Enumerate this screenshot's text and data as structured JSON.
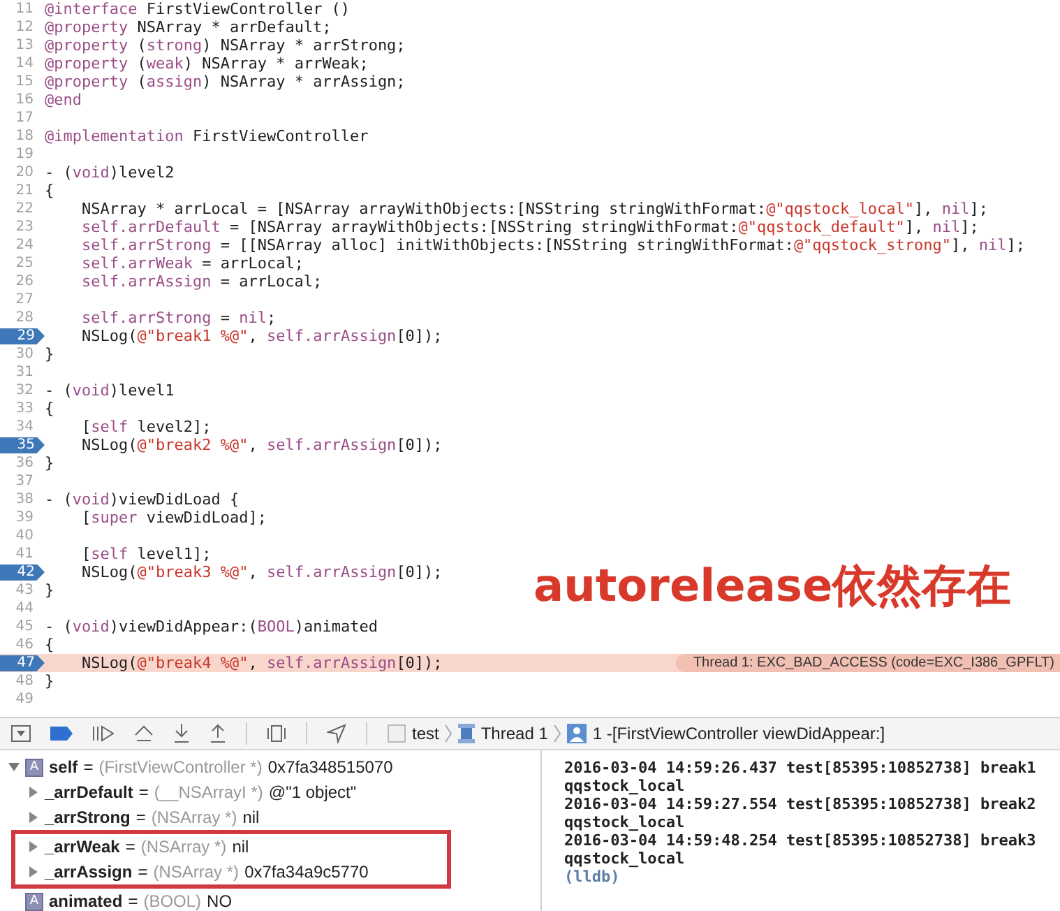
{
  "editor": {
    "lines": [
      {
        "number": "11",
        "tokens": [
          {
            "kind": "keyword",
            "text": "@interface"
          },
          {
            "kind": "plain",
            "text": " FirstViewController ()"
          }
        ]
      },
      {
        "number": "12",
        "tokens": [
          {
            "kind": "keyword",
            "text": "@property"
          },
          {
            "kind": "plain",
            "text": " NSArray * arrDefault;"
          }
        ]
      },
      {
        "number": "13",
        "tokens": [
          {
            "kind": "keyword",
            "text": "@property"
          },
          {
            "kind": "plain",
            "text": " ("
          },
          {
            "kind": "keyword",
            "text": "strong"
          },
          {
            "kind": "plain",
            "text": ") NSArray * arrStrong;"
          }
        ]
      },
      {
        "number": "14",
        "tokens": [
          {
            "kind": "keyword",
            "text": "@property"
          },
          {
            "kind": "plain",
            "text": " ("
          },
          {
            "kind": "keyword",
            "text": "weak"
          },
          {
            "kind": "plain",
            "text": ") NSArray * arrWeak;"
          }
        ]
      },
      {
        "number": "15",
        "tokens": [
          {
            "kind": "keyword",
            "text": "@property"
          },
          {
            "kind": "plain",
            "text": " ("
          },
          {
            "kind": "keyword",
            "text": "assign"
          },
          {
            "kind": "plain",
            "text": ") NSArray * arrAssign;"
          }
        ]
      },
      {
        "number": "16",
        "tokens": [
          {
            "kind": "keyword",
            "text": "@end"
          }
        ]
      },
      {
        "number": "17"
      },
      {
        "number": "18",
        "tokens": [
          {
            "kind": "keyword",
            "text": "@implementation"
          },
          {
            "kind": "plain",
            "text": " FirstViewController"
          }
        ]
      },
      {
        "number": "19"
      },
      {
        "number": "20",
        "tokens": [
          {
            "kind": "plain",
            "text": "- ("
          },
          {
            "kind": "keyword",
            "text": "void"
          },
          {
            "kind": "plain",
            "text": ")level2"
          }
        ]
      },
      {
        "number": "21",
        "tokens": [
          {
            "kind": "plain",
            "text": "{"
          }
        ]
      },
      {
        "number": "22",
        "indent": true,
        "tokens": [
          {
            "kind": "plain",
            "text": "NSArray * arrLocal = [NSArray arrayWithObjects:[NSString stringWithFormat:"
          },
          {
            "kind": "string",
            "text": "@\"qqstock_local\""
          },
          {
            "kind": "plain",
            "text": "], "
          },
          {
            "kind": "keyword",
            "text": "nil"
          },
          {
            "kind": "plain",
            "text": "];"
          }
        ]
      },
      {
        "number": "23",
        "indent": true,
        "tokens": [
          {
            "kind": "keyword",
            "text": "self.arrDefault"
          },
          {
            "kind": "plain",
            "text": " = [NSArray arrayWithObjects:[NSString stringWithFormat:"
          },
          {
            "kind": "string",
            "text": "@\"qqstock_default\""
          },
          {
            "kind": "plain",
            "text": "], "
          },
          {
            "kind": "keyword",
            "text": "nil"
          },
          {
            "kind": "plain",
            "text": "];"
          }
        ]
      },
      {
        "number": "24",
        "indent": true,
        "tokens": [
          {
            "kind": "keyword",
            "text": "self.arrStrong"
          },
          {
            "kind": "plain",
            "text": " = [[NSArray alloc] initWithObjects:[NSString stringWithFormat:"
          },
          {
            "kind": "string",
            "text": "@\"qqstock_strong\""
          },
          {
            "kind": "plain",
            "text": "], "
          },
          {
            "kind": "keyword",
            "text": "nil"
          },
          {
            "kind": "plain",
            "text": "];"
          }
        ]
      },
      {
        "number": "25",
        "indent": true,
        "tokens": [
          {
            "kind": "keyword",
            "text": "self.arrWeak"
          },
          {
            "kind": "plain",
            "text": " = arrLocal;"
          }
        ]
      },
      {
        "number": "26",
        "indent": true,
        "tokens": [
          {
            "kind": "keyword",
            "text": "self.arrAssign"
          },
          {
            "kind": "plain",
            "text": " = arrLocal;"
          }
        ]
      },
      {
        "number": "27"
      },
      {
        "number": "28",
        "indent": true,
        "tokens": [
          {
            "kind": "keyword",
            "text": "self.arrStrong"
          },
          {
            "kind": "plain",
            "text": " = "
          },
          {
            "kind": "keyword",
            "text": "nil"
          },
          {
            "kind": "plain",
            "text": ";"
          }
        ]
      },
      {
        "number": "29",
        "breakpoint": true,
        "indent": true,
        "tokens": [
          {
            "kind": "plain",
            "text": "NSLog("
          },
          {
            "kind": "string",
            "text": "@\"break1 %@\""
          },
          {
            "kind": "plain",
            "text": ", "
          },
          {
            "kind": "keyword",
            "text": "self.arrAssign"
          },
          {
            "kind": "plain",
            "text": "[0]);"
          }
        ]
      },
      {
        "number": "30",
        "tokens": [
          {
            "kind": "plain",
            "text": "}"
          }
        ]
      },
      {
        "number": "31"
      },
      {
        "number": "32",
        "tokens": [
          {
            "kind": "plain",
            "text": "- ("
          },
          {
            "kind": "keyword",
            "text": "void"
          },
          {
            "kind": "plain",
            "text": ")level1"
          }
        ]
      },
      {
        "number": "33",
        "tokens": [
          {
            "kind": "plain",
            "text": "{"
          }
        ]
      },
      {
        "number": "34",
        "indent": true,
        "tokens": [
          {
            "kind": "plain",
            "text": "["
          },
          {
            "kind": "keyword",
            "text": "self"
          },
          {
            "kind": "plain",
            "text": " level2];"
          }
        ]
      },
      {
        "number": "35",
        "breakpoint": true,
        "indent": true,
        "tokens": [
          {
            "kind": "plain",
            "text": "NSLog("
          },
          {
            "kind": "string",
            "text": "@\"break2 %@\""
          },
          {
            "kind": "plain",
            "text": ", "
          },
          {
            "kind": "keyword",
            "text": "self.arrAssign"
          },
          {
            "kind": "plain",
            "text": "[0]);"
          }
        ]
      },
      {
        "number": "36",
        "tokens": [
          {
            "kind": "plain",
            "text": "}"
          }
        ]
      },
      {
        "number": "37"
      },
      {
        "number": "38",
        "tokens": [
          {
            "kind": "plain",
            "text": "- ("
          },
          {
            "kind": "keyword",
            "text": "void"
          },
          {
            "kind": "plain",
            "text": ")viewDidLoad {"
          }
        ]
      },
      {
        "number": "39",
        "indent": true,
        "tokens": [
          {
            "kind": "plain",
            "text": "["
          },
          {
            "kind": "keyword",
            "text": "super"
          },
          {
            "kind": "plain",
            "text": " viewDidLoad];"
          }
        ]
      },
      {
        "number": "40"
      },
      {
        "number": "41",
        "indent": true,
        "tokens": [
          {
            "kind": "plain",
            "text": "["
          },
          {
            "kind": "keyword",
            "text": "self"
          },
          {
            "kind": "plain",
            "text": " level1];"
          }
        ]
      },
      {
        "number": "42",
        "breakpoint": true,
        "indent": true,
        "tokens": [
          {
            "kind": "plain",
            "text": "NSLog("
          },
          {
            "kind": "string",
            "text": "@\"break3 %@\""
          },
          {
            "kind": "plain",
            "text": ", "
          },
          {
            "kind": "keyword",
            "text": "self.arrAssign"
          },
          {
            "kind": "plain",
            "text": "[0]);"
          }
        ]
      },
      {
        "number": "43",
        "tokens": [
          {
            "kind": "plain",
            "text": "}"
          }
        ]
      },
      {
        "number": "44"
      },
      {
        "number": "45",
        "tokens": [
          {
            "kind": "plain",
            "text": "- ("
          },
          {
            "kind": "keyword",
            "text": "void"
          },
          {
            "kind": "plain",
            "text": ")viewDidAppear:("
          },
          {
            "kind": "keyword",
            "text": "BOOL"
          },
          {
            "kind": "plain",
            "text": ")animated"
          }
        ]
      },
      {
        "number": "46",
        "tokens": [
          {
            "kind": "plain",
            "text": "{"
          }
        ]
      },
      {
        "number": "47",
        "breakpoint": true,
        "current": true,
        "indent": true,
        "message": "Thread 1: EXC_BAD_ACCESS (code=EXC_I386_GPFLT)",
        "tokens": [
          {
            "kind": "plain",
            "text": "NSLog("
          },
          {
            "kind": "string",
            "text": "@\"break4 %@\""
          },
          {
            "kind": "plain",
            "text": ", "
          },
          {
            "kind": "keyword",
            "text": "self.arrAssign"
          },
          {
            "kind": "plain",
            "text": "[0]);"
          }
        ]
      },
      {
        "number": "48",
        "tokens": [
          {
            "kind": "plain",
            "text": "}"
          }
        ]
      },
      {
        "number": "49"
      }
    ],
    "annotation": "autorelease依然存在"
  },
  "debug_bar": {
    "breadcrumbs": [
      {
        "kind": "project",
        "label": "test"
      },
      {
        "kind": "thread",
        "label": "Thread 1"
      },
      {
        "kind": "frame",
        "label": "1 -[FirstViewController viewDidAppear:]"
      }
    ]
  },
  "variables": [
    {
      "badge": "A",
      "name": "self",
      "sign": "=",
      "type": "(FirstViewController *)",
      "value": "0x7fa348515070",
      "expanded": true,
      "children": [
        {
          "name": "_arrDefault",
          "sign": "=",
          "type": "(__NSArrayI *)",
          "value": "@\"1 object\"",
          "expanded": false
        },
        {
          "name": "_arrStrong",
          "sign": "=",
          "type": "(NSArray *)",
          "value": "nil",
          "expanded": false
        },
        {
          "name": "_arrWeak",
          "sign": "=",
          "type": "(NSArray *)",
          "value": "nil",
          "expanded": false,
          "boxed": true
        },
        {
          "name": "_arrAssign",
          "sign": "=",
          "type": "(NSArray *)",
          "value": "0x7fa34a9c5770",
          "expanded": false,
          "boxed": true
        }
      ]
    },
    {
      "badge": "A",
      "name": "animated",
      "sign": "=",
      "type": "(BOOL)",
      "value": "NO"
    }
  ],
  "console": [
    {
      "kind": "output",
      "text": "2016-03-04 14:59:26.437 test[85395:10852738] break1"
    },
    {
      "kind": "output",
      "text": "qqstock_local"
    },
    {
      "kind": "output",
      "text": "2016-03-04 14:59:27.554 test[85395:10852738] break2"
    },
    {
      "kind": "output",
      "text": "qqstock_local"
    },
    {
      "kind": "output",
      "text": "2016-03-04 14:59:48.254 test[85395:10852738] break3"
    },
    {
      "kind": "output",
      "text": "qqstock_local"
    },
    {
      "kind": "prompt",
      "text": "(lldb)"
    }
  ]
}
